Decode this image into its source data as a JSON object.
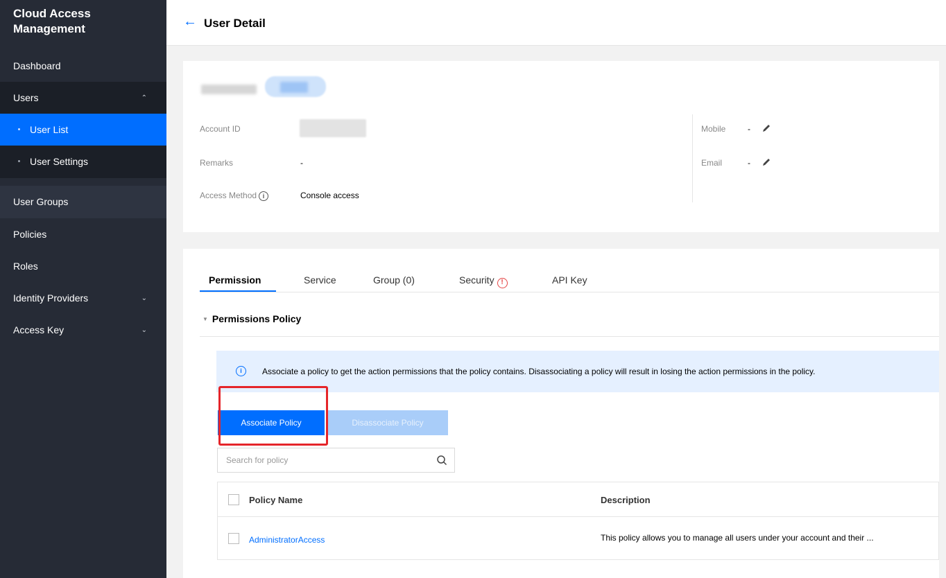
{
  "sidebar": {
    "app_title": "Cloud Access Management",
    "items": {
      "dashboard": "Dashboard",
      "users": "Users",
      "user_list": "User List",
      "user_settings": "User Settings",
      "user_groups": "User Groups",
      "policies": "Policies",
      "roles": "Roles",
      "identity_providers": "Identity Providers",
      "access_key": "Access Key"
    },
    "icons": {
      "users_expand": "chevron-up-icon",
      "collapse": "chevron-down-icon"
    }
  },
  "header": {
    "title": "User Detail",
    "back_icon": "arrow-left-icon"
  },
  "user_info": {
    "account_id_label": "Account ID",
    "remarks_label": "Remarks",
    "remarks_value": "-",
    "access_method_label": "Access Method",
    "access_method_value": "Console access",
    "mobile_label": "Mobile",
    "mobile_value": "-",
    "email_label": "Email",
    "email_value": "-"
  },
  "tabs": {
    "permission": "Permission",
    "service": "Service",
    "group": "Group (0)",
    "security": "Security",
    "api_key": "API Key"
  },
  "permissions_policy": {
    "heading": "Permissions Policy",
    "notice": "Associate a policy to get the action permissions that the policy contains. Disassociating a policy will result in losing the action permissions in the policy.",
    "associate_button": "Associate Policy",
    "disassociate_button": "Disassociate Policy",
    "search_placeholder": "Search for policy",
    "columns": {
      "name": "Policy Name",
      "description": "Description"
    },
    "rows": [
      {
        "name": "AdministratorAccess",
        "description": "This policy allows you to manage all users under your account and their ..."
      }
    ]
  },
  "colors": {
    "accent": "#006eff",
    "sidebar_bg": "#262b36",
    "highlight": "#e5252a",
    "warning": "#e54545"
  }
}
